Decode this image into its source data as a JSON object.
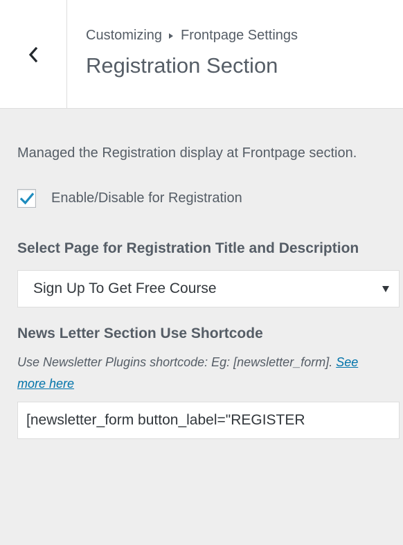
{
  "header": {
    "breadcrumb_prefix": "Customizing",
    "breadcrumb_parent": "Frontpage Settings",
    "section_title": "Registration Section",
    "back_icon": "chevron-left-icon"
  },
  "section": {
    "description": "Managed the Registration display at Frontpage section.",
    "enable_checkbox": {
      "label": "Enable/Disable for Registration",
      "checked": true,
      "icon": "checkmark-icon"
    },
    "page_select": {
      "title": "Select Page for Registration Title and Description",
      "selected": "Sign Up To Get Free Course"
    },
    "newsletter": {
      "title": "News Letter Section Use Shortcode",
      "description": "Use Newsletter Plugins shortcode: Eg: [newsletter_form].",
      "link_text": "See more here",
      "input_value": "[newsletter_form button_label=\"REGISTER"
    }
  },
  "colors": {
    "check_color": "#1e8cbe",
    "link_color": "#0073aa",
    "text_color": "#555d66",
    "panel_bg": "#eeeeee"
  }
}
